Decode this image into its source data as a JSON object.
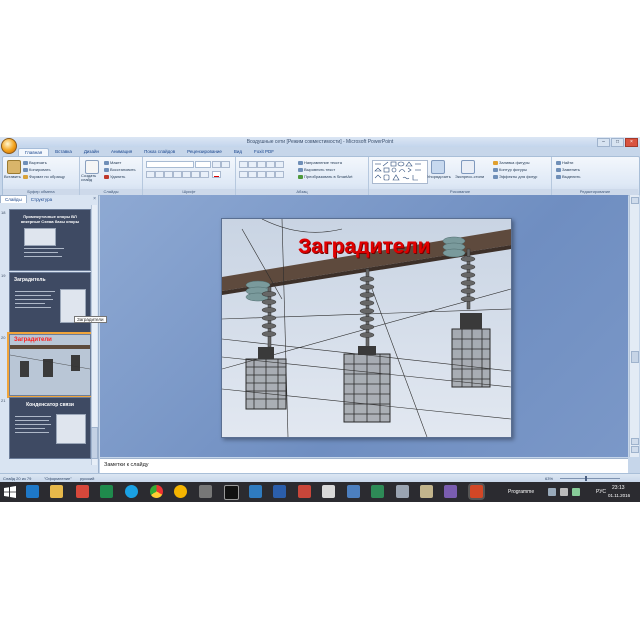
{
  "window": {
    "title": "Воздушные сети [Режим совместимости] - Microsoft PowerPoint",
    "controls": [
      "–",
      "□",
      "×"
    ]
  },
  "ribbon": {
    "tabs": [
      "Главная",
      "Вставка",
      "Дизайн",
      "Анимация",
      "Показ слайдов",
      "Рецензирование",
      "Вид",
      "Foxit PDF"
    ],
    "active_tab": "Главная",
    "groups": {
      "clipboard": {
        "title": "Буфер обмена",
        "paste": "Вставить",
        "cut": "Вырезать",
        "copy": "Копировать",
        "format": "Формат по образцу"
      },
      "slides": {
        "title": "Слайды",
        "new_slide": "Создать слайд",
        "layout": "Макет",
        "reset": "Восстановить",
        "delete": "Удалить"
      },
      "font": {
        "title": "Шрифт"
      },
      "paragraph": {
        "title": "Абзац",
        "direction": "Направление текста",
        "align": "Выровнять текст",
        "smartart": "Преобразовать в SmartArt"
      },
      "drawing": {
        "title": "Рисование",
        "arrange": "Упорядочить",
        "quick_styles": "Экспресс-стили",
        "fill": "Заливка фигуры",
        "outline": "Контур фигуры",
        "effects": "Эффекты для фигур"
      },
      "editing": {
        "title": "Редактирование",
        "find": "Найти",
        "replace": "Заменить",
        "select": "Выделить"
      }
    }
  },
  "left_panel": {
    "tabs": [
      "Слайды",
      "Структура"
    ],
    "close": "×",
    "thumbnails": [
      {
        "num": "18",
        "title": "Промежуточные опоры ВЛ анкерные Схема базы опоры"
      },
      {
        "num": "19",
        "title": "Заградитель"
      },
      {
        "num": "20",
        "title": "Заградители"
      },
      {
        "num": "21",
        "title": "Конденсатор связи"
      }
    ],
    "tooltip": "Заградители"
  },
  "slide": {
    "title": "Заградители"
  },
  "notes": {
    "placeholder": "Заметки к слайду"
  },
  "status_bar": {
    "slide_info": "Слайд 20 из 79",
    "theme": "\"Оформление\"",
    "language": "русский",
    "zoom": "63%"
  },
  "taskbar": {
    "apps": [
      "file-explorer",
      "internet-explorer",
      "file-manager",
      "media",
      "excel",
      "skype",
      "skype",
      "chrome",
      "archive",
      "tool",
      "console",
      "network",
      "word",
      "writer",
      "docs",
      "pdf",
      "excel-alt",
      "printer",
      "text",
      "photos",
      "powerpoint"
    ],
    "tray_label": "Programme",
    "language": "РУС",
    "time": "23:13",
    "date": "01.11.2016"
  },
  "colors": {
    "ribbon_bg": "#dfe9f6",
    "slide_area": "#7b98c8",
    "title_red": "#e00000",
    "taskbar": "#2b2b30"
  }
}
